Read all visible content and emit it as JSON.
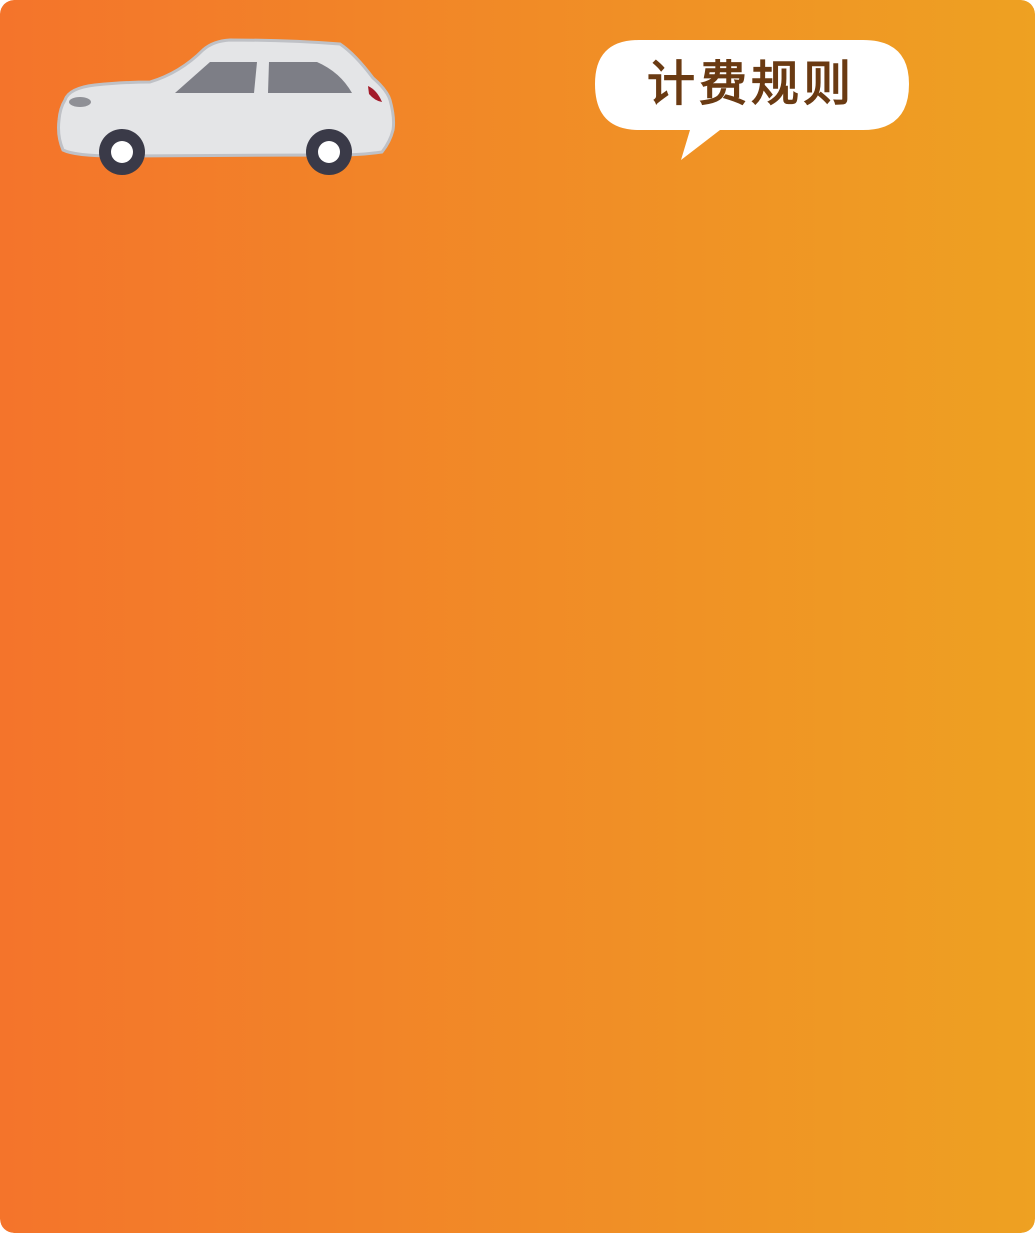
{
  "header": {
    "rules_label": "计费规则"
  },
  "car": {
    "icon": "car-icon",
    "body_color": "#e4e5e7",
    "window_color": "#7d7e86",
    "wheel_color": "#3a3a48",
    "taillight_color": "#a31b2a"
  },
  "colors": {
    "gradient_start": "#f4742b",
    "gradient_end": "#eea122",
    "bubble_fill": "#ffffff",
    "label_text": "#6a3a12"
  }
}
